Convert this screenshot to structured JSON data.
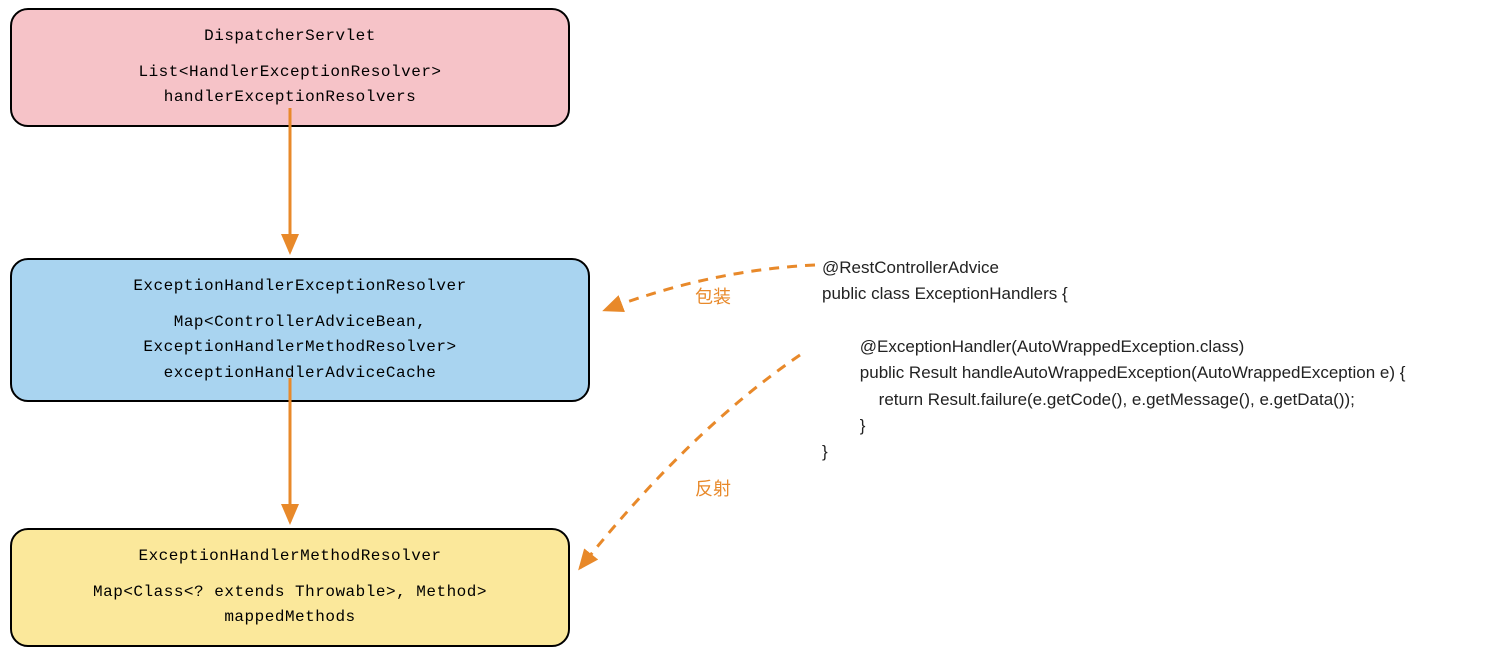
{
  "nodes": {
    "dispatcher": {
      "title": "DispatcherServlet",
      "field": "List<HandlerExceptionResolver> handlerExceptionResolvers"
    },
    "resolver1": {
      "title": "ExceptionHandlerExceptionResolver",
      "field": "Map<ControllerAdviceBean, ExceptionHandlerMethodResolver> exceptionHandlerAdviceCache"
    },
    "resolver2": {
      "title": "ExceptionHandlerMethodResolver",
      "field": "Map<Class<? extends Throwable>, Method> mappedMethods"
    }
  },
  "labels": {
    "wrap": "包装",
    "reflect": "反射"
  },
  "code": "@RestControllerAdvice\npublic class ExceptionHandlers {\n\n        @ExceptionHandler(AutoWrappedException.class)\n        public Result handleAutoWrappedException(AutoWrappedException e) {\n            return Result.failure(e.getCode(), e.getMessage(), e.getData());\n        }\n}",
  "colors": {
    "arrow": "#e8892a"
  }
}
